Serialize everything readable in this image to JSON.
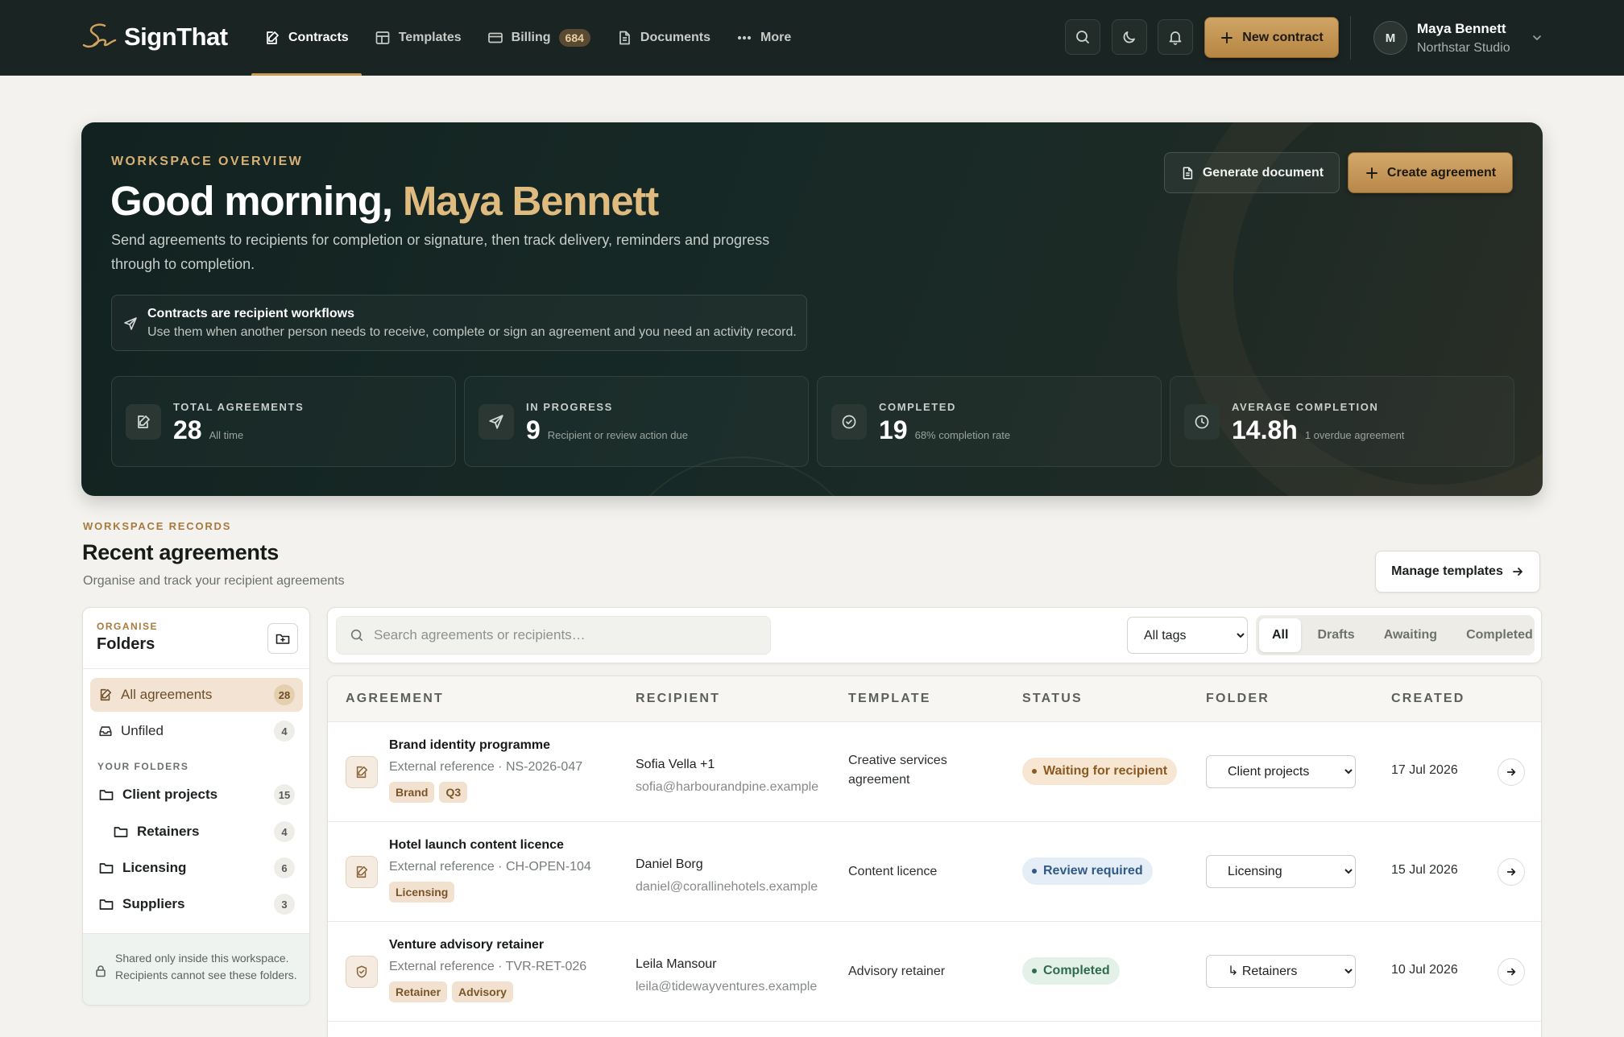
{
  "brand": {
    "name": "SignThat"
  },
  "nav": {
    "items": [
      {
        "label": "Contracts",
        "icon": "contract-icon",
        "active": true
      },
      {
        "label": "Templates",
        "icon": "templates-icon"
      },
      {
        "label": "Billing",
        "icon": "card-icon",
        "badge": "684"
      },
      {
        "label": "Documents",
        "icon": "document-icon"
      },
      {
        "label": "More",
        "icon": "more-icon"
      }
    ],
    "new_contract_label": "New contract",
    "user": {
      "initial": "M",
      "name": "Maya Bennett",
      "org": "Northstar Studio"
    }
  },
  "hero": {
    "eyebrow": "WORKSPACE OVERVIEW",
    "greeting": "Good morning, ",
    "name": "Maya Bennett",
    "description": "Send agreements to recipients for completion or signature, then track delivery, reminders and progress through to completion.",
    "info": {
      "title": "Contracts are recipient workflows",
      "text": "Use them when another person needs to receive, complete or sign an agreement and you need an activity record."
    },
    "generate_label": "Generate document",
    "create_label": "Create agreement",
    "stats": [
      {
        "label": "TOTAL AGREEMENTS",
        "value": "28",
        "sub": "All time",
        "icon": "contract-icon"
      },
      {
        "label": "IN PROGRESS",
        "value": "9",
        "sub": "Recipient or review action due",
        "icon": "send-icon"
      },
      {
        "label": "COMPLETED",
        "value": "19",
        "sub": "68% completion rate",
        "icon": "check-circle-icon"
      },
      {
        "label": "AVERAGE COMPLETION",
        "value": "14.8h",
        "sub": "1 overdue agreement",
        "icon": "clock-icon"
      }
    ]
  },
  "records": {
    "eyebrow": "WORKSPACE RECORDS",
    "title": "Recent agreements",
    "subtitle": "Organise and track your recipient agreements",
    "manage_label": "Manage templates"
  },
  "folders": {
    "eyebrow": "ORGANISE",
    "title": "Folders",
    "all": {
      "label": "All agreements",
      "count": "28"
    },
    "unfiled": {
      "label": "Unfiled",
      "count": "4"
    },
    "group_label": "YOUR FOLDERS",
    "list": [
      {
        "label": "Client projects",
        "count": "15"
      },
      {
        "label": "Retainers",
        "count": "4"
      },
      {
        "label": "Licensing",
        "count": "6"
      },
      {
        "label": "Suppliers",
        "count": "3"
      }
    ],
    "note": "Shared only inside this workspace. Recipients cannot see these folders."
  },
  "filters": {
    "search_placeholder": "Search agreements or recipients…",
    "tag_select": "All tags",
    "tabs": [
      "All",
      "Drafts",
      "Awaiting",
      "Completed"
    ]
  },
  "table": {
    "headers": [
      "AGREEMENT",
      "RECIPIENT",
      "TEMPLATE",
      "STATUS",
      "FOLDER",
      "CREATED"
    ],
    "rows": [
      {
        "title": "Brand identity programme",
        "ref": "External reference · NS-2026-047",
        "tags": [
          "Brand",
          "Q3"
        ],
        "recipient": "Sofia Vella +1",
        "email": "sofia@harbourandpine.example",
        "template_line1": "Creative services",
        "template_line2": "agreement",
        "status": "Waiting for recipient",
        "status_colors": {
          "fg": "#8a5a22",
          "bg": "#f6e6d2"
        },
        "folder": "Client projects",
        "created": "17 Jul 2026"
      },
      {
        "title": "Hotel launch content licence",
        "ref": "External reference · CH-OPEN-104",
        "tags": [
          "Licensing"
        ],
        "recipient": "Daniel Borg",
        "email": "daniel@corallinehotels.example",
        "template_line1": "Content licence",
        "status": "Review required",
        "status_colors": {
          "fg": "#2e5a86",
          "bg": "#e5edf6"
        },
        "folder": "Licensing",
        "created": "15 Jul 2026"
      },
      {
        "title": "Venture advisory retainer",
        "ref": "External reference · TVR-RET-026",
        "tags": [
          "Retainer",
          "Advisory"
        ],
        "recipient": "Leila Mansour",
        "email": "leila@tidewayventures.example",
        "template_line1": "Advisory retainer",
        "status": "Completed",
        "status_colors": {
          "fg": "#2f6b4c",
          "bg": "#e3f1e8"
        },
        "folder": "↳ Retainers",
        "created": "10 Jul 2026"
      }
    ]
  }
}
